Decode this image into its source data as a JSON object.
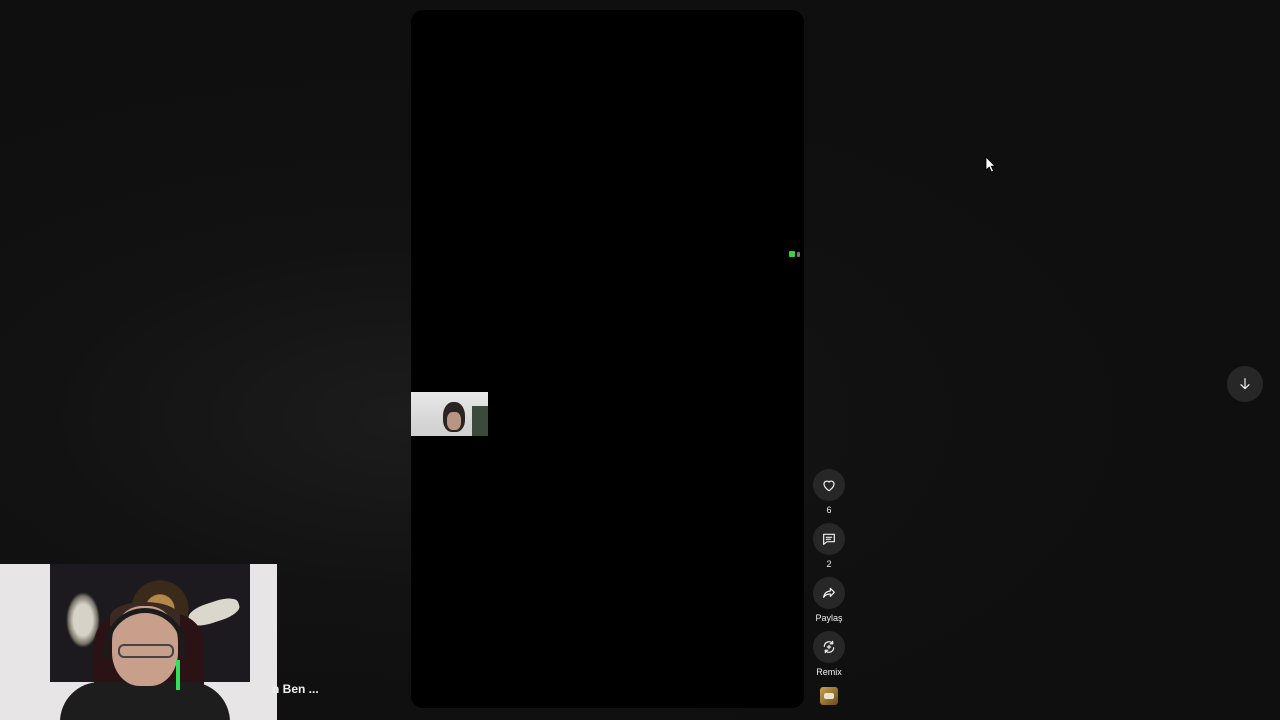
{
  "actions": {
    "like_count": "6",
    "comment_count": "2",
    "share_label": "Paylaş",
    "remix_label": "Remix"
  },
  "overlay": {
    "channel_text": "n Ben ..."
  },
  "icons": {
    "like": "heart-icon",
    "comment": "comment-icon",
    "share": "share-icon",
    "remix": "remix-icon",
    "next": "arrow-down-icon"
  },
  "colors": {
    "background": "#0f0f0f",
    "button": "#272727",
    "status_green": "#3bd13b"
  }
}
